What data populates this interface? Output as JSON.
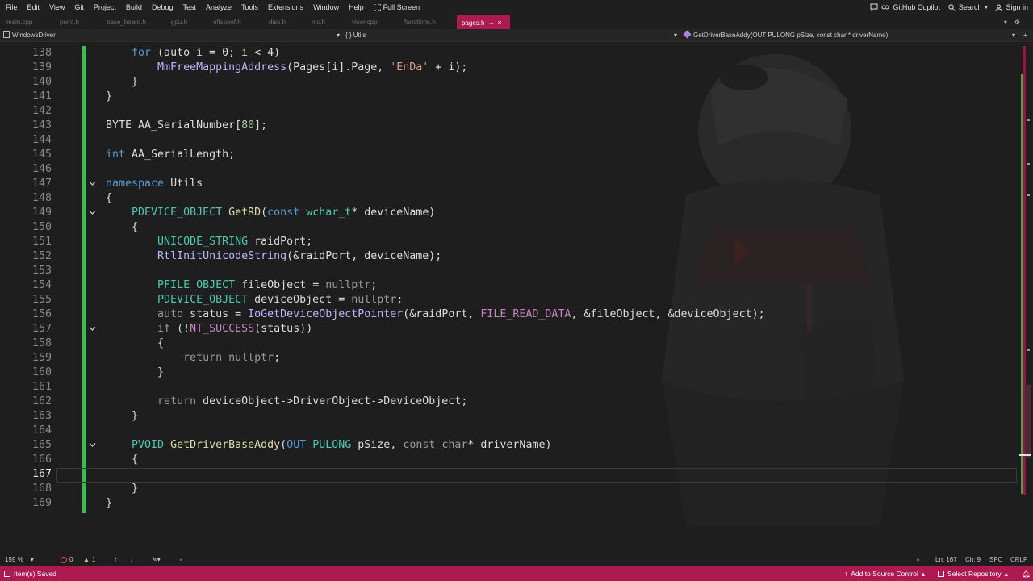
{
  "menu": {
    "items": [
      "File",
      "Edit",
      "View",
      "Git",
      "Project",
      "Build",
      "Debug",
      "Test",
      "Analyze",
      "Tools",
      "Extensions",
      "Window",
      "Help"
    ],
    "fullscreen": "Full Screen",
    "copilot": "GitHub Copilot",
    "search": "Search",
    "signin": "Sign in"
  },
  "tabs": {
    "items": [
      "main.cpp",
      "point.h",
      "base_board.h",
      "gpu.h",
      "efispoof.h",
      "disk.h",
      "nic.h",
      "visor.cpp",
      "functions.h"
    ],
    "active": "pages.h"
  },
  "nav": {
    "project": "WindowsDriver",
    "scope": "{ } Utils",
    "member": "GetDriverBaseAddy(OUT PULONG pSize, const char * driverName)"
  },
  "editor": {
    "current_line": 167,
    "lines": [
      {
        "num": "138",
        "code": [
          [
            "k",
            "    for"
          ],
          [
            "pl",
            " (auto i = 0; i < 4)"
          ]
        ]
      },
      {
        "num": "139",
        "code": [
          [
            "pl",
            "        "
          ],
          [
            "m",
            "MmFreeMappingAddress"
          ],
          [
            "pl",
            "(Pages[i].Page, "
          ],
          [
            "s",
            "'EnDa'"
          ],
          [
            "pl",
            " + i);"
          ]
        ]
      },
      {
        "num": "140",
        "code": [
          [
            "pl",
            "    }"
          ]
        ]
      },
      {
        "num": "141",
        "code": [
          [
            "pl",
            "}"
          ]
        ]
      },
      {
        "num": "142",
        "code": []
      },
      {
        "num": "143",
        "code": [
          [
            "pl",
            "BYTE AA_SerialNumber["
          ],
          [
            "n",
            "80"
          ],
          [
            "pl",
            "];"
          ]
        ]
      },
      {
        "num": "144",
        "code": []
      },
      {
        "num": "145",
        "code": [
          [
            "k",
            "int"
          ],
          [
            "pl",
            " AA_SerialLength;"
          ]
        ]
      },
      {
        "num": "146",
        "code": []
      },
      {
        "num": "147",
        "code": [
          [
            "k",
            "namespace"
          ],
          [
            "pl",
            " Utils"
          ]
        ]
      },
      {
        "num": "148",
        "code": [
          [
            "pl",
            "{"
          ]
        ]
      },
      {
        "num": "149",
        "code": [
          [
            "pl",
            "    "
          ],
          [
            "t",
            "PDEVICE_OBJECT"
          ],
          [
            "pl",
            " "
          ],
          [
            "f",
            "GetRD"
          ],
          [
            "pl",
            "("
          ],
          [
            "k",
            "const"
          ],
          [
            "pl",
            " "
          ],
          [
            "t",
            "wchar_t"
          ],
          [
            "pl",
            "* deviceName)"
          ]
        ]
      },
      {
        "num": "150",
        "code": [
          [
            "pl",
            "    {"
          ]
        ]
      },
      {
        "num": "151",
        "code": [
          [
            "pl",
            "        "
          ],
          [
            "t",
            "UNICODE_STRING"
          ],
          [
            "pl",
            " raidPort;"
          ]
        ]
      },
      {
        "num": "152",
        "code": [
          [
            "pl",
            "        "
          ],
          [
            "m",
            "RtlInitUnicodeString"
          ],
          [
            "pl",
            "(&raidPort, deviceName);"
          ]
        ]
      },
      {
        "num": "153",
        "code": []
      },
      {
        "num": "154",
        "code": [
          [
            "pl",
            "        "
          ],
          [
            "t",
            "PFILE_OBJECT"
          ],
          [
            "pl",
            " fileObject = "
          ],
          [
            "g",
            "nullptr"
          ],
          [
            "pl",
            ";"
          ]
        ]
      },
      {
        "num": "155",
        "code": [
          [
            "pl",
            "        "
          ],
          [
            "t",
            "PDEVICE_OBJECT"
          ],
          [
            "pl",
            " deviceObject = "
          ],
          [
            "g",
            "nullptr"
          ],
          [
            "pl",
            ";"
          ]
        ]
      },
      {
        "num": "156",
        "code": [
          [
            "pl",
            "        "
          ],
          [
            "g",
            "auto"
          ],
          [
            "pl",
            " status = "
          ],
          [
            "m",
            "IoGetDeviceObjectPointer"
          ],
          [
            "pl",
            "(&raidPort, "
          ],
          [
            "kc",
            "FILE_READ_DATA"
          ],
          [
            "pl",
            ", &fileObject, &deviceObject);"
          ]
        ]
      },
      {
        "num": "157",
        "code": [
          [
            "pl",
            "        "
          ],
          [
            "g",
            "if"
          ],
          [
            "pl",
            " (!"
          ],
          [
            "kc",
            "NT_SUCCESS"
          ],
          [
            "pl",
            "(status))"
          ]
        ]
      },
      {
        "num": "158",
        "code": [
          [
            "pl",
            "        {"
          ]
        ]
      },
      {
        "num": "159",
        "code": [
          [
            "pl",
            "            "
          ],
          [
            "g",
            "return"
          ],
          [
            "pl",
            " "
          ],
          [
            "g",
            "nullptr"
          ],
          [
            "pl",
            ";"
          ]
        ]
      },
      {
        "num": "160",
        "code": [
          [
            "pl",
            "        }"
          ]
        ]
      },
      {
        "num": "161",
        "code": []
      },
      {
        "num": "162",
        "code": [
          [
            "pl",
            "        "
          ],
          [
            "g",
            "return"
          ],
          [
            "pl",
            " deviceObject->DriverObject->DeviceObject;"
          ]
        ]
      },
      {
        "num": "163",
        "code": [
          [
            "pl",
            "    }"
          ]
        ]
      },
      {
        "num": "164",
        "code": []
      },
      {
        "num": "165",
        "code": [
          [
            "pl",
            "    "
          ],
          [
            "t",
            "PVOID"
          ],
          [
            "pl",
            " "
          ],
          [
            "f",
            "GetDriverBaseAddy"
          ],
          [
            "pl",
            "("
          ],
          [
            "k",
            "OUT"
          ],
          [
            "pl",
            " "
          ],
          [
            "t",
            "PULONG"
          ],
          [
            "pl",
            " pSize, "
          ],
          [
            "g",
            "const char"
          ],
          [
            "pl",
            "* driverName)"
          ]
        ]
      },
      {
        "num": "166",
        "code": [
          [
            "pl",
            "    {"
          ]
        ]
      },
      {
        "num": "167",
        "code": []
      },
      {
        "num": "168",
        "code": [
          [
            "pl",
            "    }"
          ]
        ]
      },
      {
        "num": "169",
        "code": [
          [
            "pl",
            "}"
          ]
        ]
      }
    ],
    "folds": [
      "147",
      "149",
      "157",
      "165"
    ]
  },
  "editor_status": {
    "zoom": "159 %",
    "errors": "0",
    "warnings": "1",
    "position": "Ln: 167",
    "column": "Ch: 9",
    "spc": "SPC",
    "eol": "CRLF"
  },
  "status": {
    "message": "Item(s) Saved",
    "source_control": "Add to Source Control",
    "repository": "Select Repository"
  }
}
